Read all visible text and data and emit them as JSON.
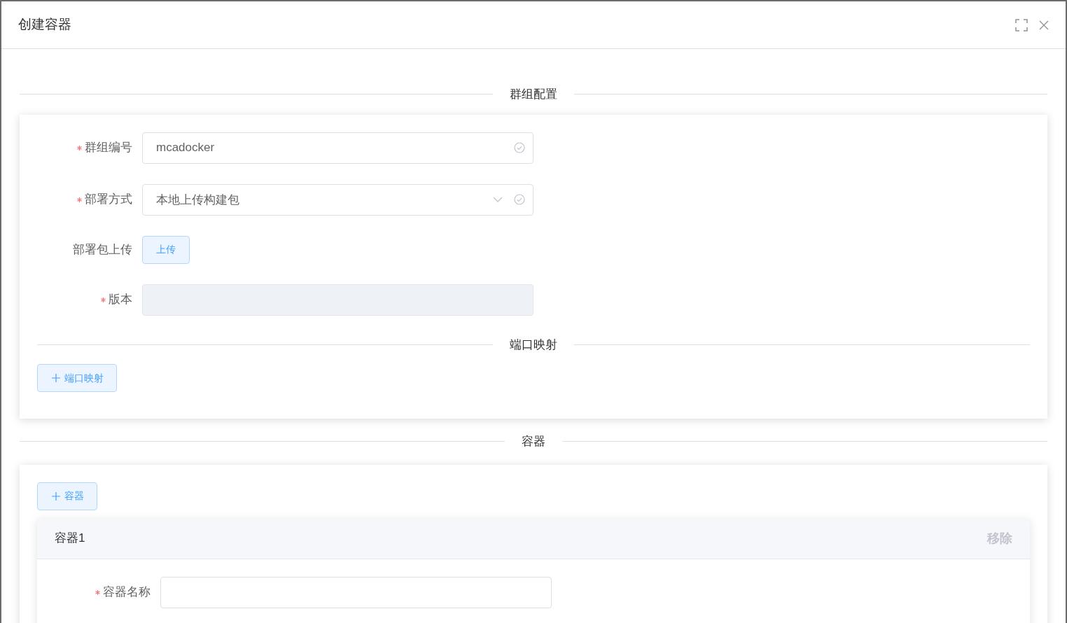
{
  "dialog": {
    "title": "创建容器"
  },
  "group_section": {
    "title": "群组配置",
    "fields": [
      {
        "kind": "input",
        "label": "群组编号",
        "required": true,
        "value": "mcadocker",
        "validated": true,
        "disabled": false
      },
      {
        "kind": "select",
        "label": "部署方式",
        "required": true,
        "value": "本地上传构建包",
        "validated": true,
        "disabled": false
      },
      {
        "kind": "upload",
        "label": "部署包上传",
        "required": false,
        "button": "上传"
      },
      {
        "kind": "input",
        "label": "版本",
        "required": true,
        "validated": false,
        "disabled": true
      }
    ],
    "port_divider": "端口映射",
    "add_port_button": "端口映射"
  },
  "container_section": {
    "title": "容器",
    "add_button": "容器",
    "containers": [
      {
        "title": "容器1",
        "remove": "移除",
        "fields": [
          {
            "kind": "input",
            "label": "容器名称",
            "required": true,
            "validated": false,
            "disabled": false
          }
        ]
      }
    ]
  }
}
